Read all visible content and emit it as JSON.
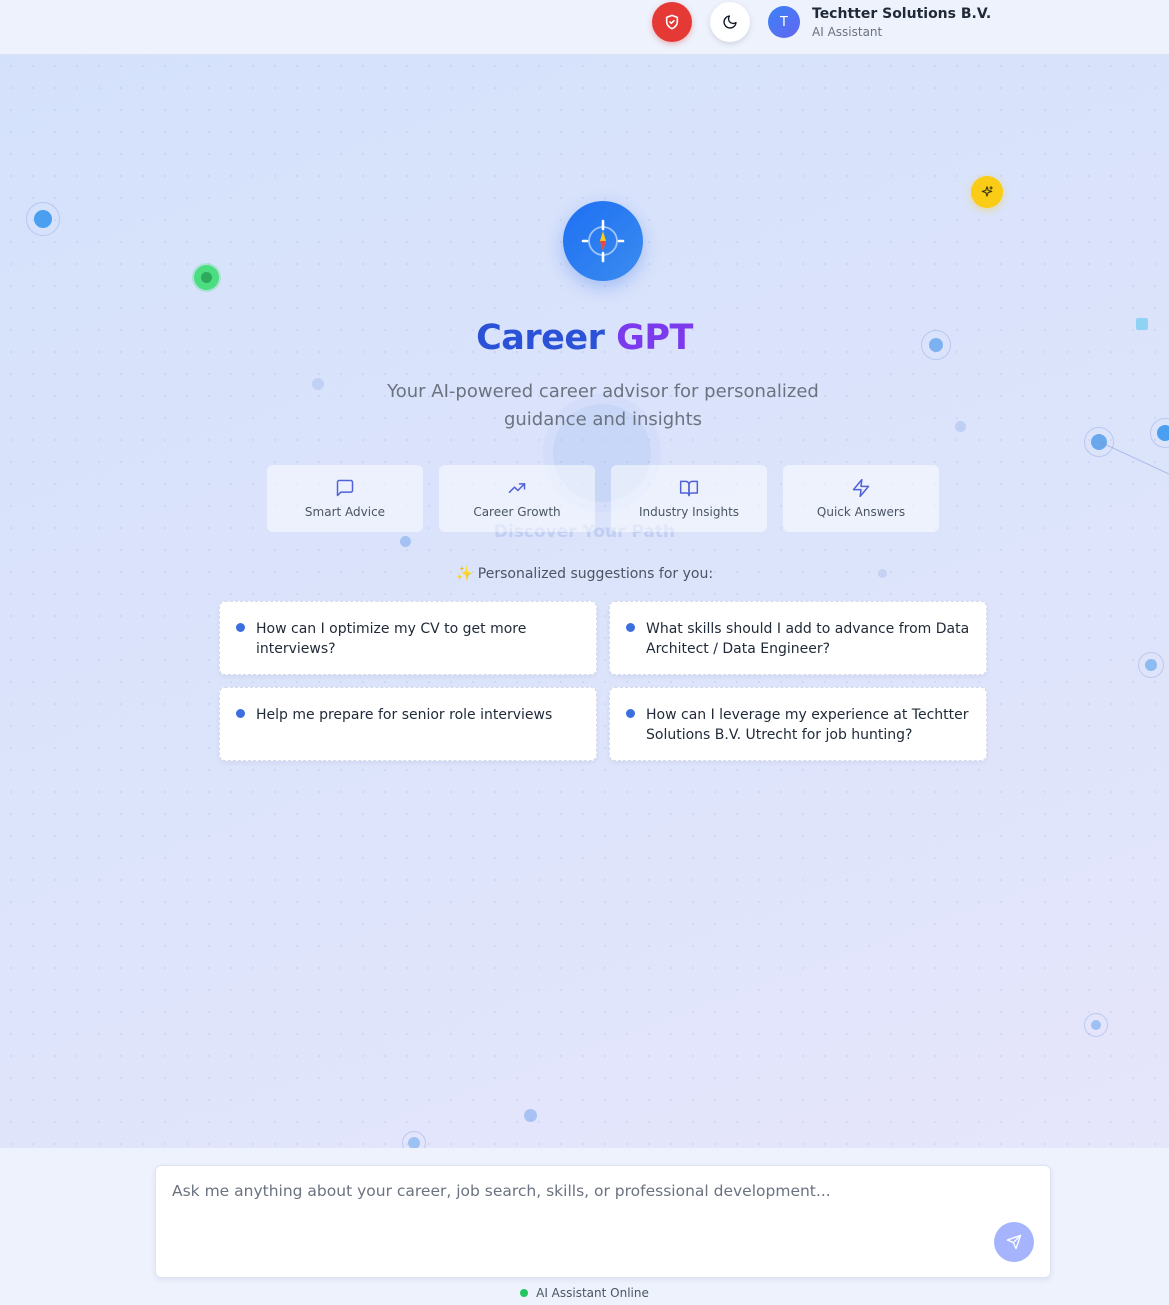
{
  "header": {
    "avatar_initial": "T",
    "company_name": "Techtter Solutions B.V.",
    "subtitle": "AI Assistant",
    "security_icon": "shield-check-icon",
    "theme_icon": "moon-icon"
  },
  "hero": {
    "logo_icon": "compass-icon",
    "title_part1": "Career",
    "title_part2": "GPT",
    "tagline": "Your AI-powered career advisor for personalized guidance and insights",
    "ghost_text": "Discover Your Path"
  },
  "features": [
    {
      "label": "Smart Advice",
      "icon": "message-square-icon"
    },
    {
      "label": "Career Growth",
      "icon": "trending-up-icon"
    },
    {
      "label": "Industry Insights",
      "icon": "book-open-icon"
    },
    {
      "label": "Quick Answers",
      "icon": "zap-icon"
    }
  ],
  "suggestions": {
    "heading": "✨ Personalized suggestions for you:",
    "items": [
      "How can I optimize my CV to get more interviews?",
      "What skills should I add to advance from Data Architect / Data Engineer?",
      "Help me prepare for senior role interviews",
      "How can I leverage my experience at Techtter Solutions B.V. Utrecht for job hunting?"
    ]
  },
  "chat": {
    "placeholder": "Ask me anything about your career, job search, skills, or professional development...",
    "value": "",
    "send_icon": "send-icon"
  },
  "status": {
    "text": "AI Assistant Online"
  },
  "colors": {
    "accent_blue": "#2b52d6",
    "accent_purple": "#7c3aed",
    "danger": "#e53935",
    "online": "#22c55e",
    "warning": "#facc15"
  }
}
